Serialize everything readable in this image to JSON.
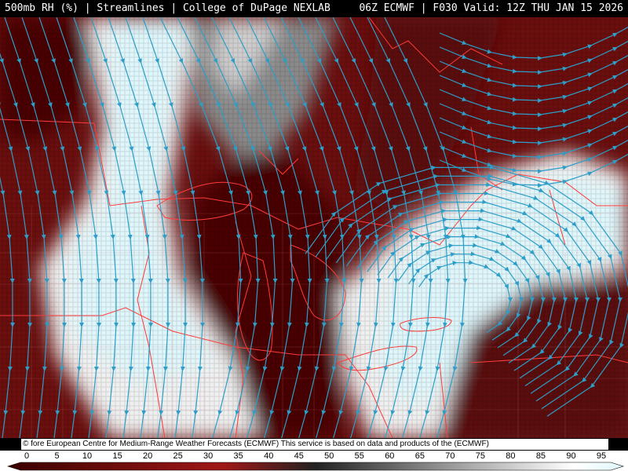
{
  "header": {
    "left": "500mb RH (%) | Streamlines | College of DuPage NEXLAB",
    "right": "06Z ECMWF | F030 Valid: 12Z THU JAN 15 2026"
  },
  "credit": "© fore European Centre for Medium-Range Weather Forecasts (ECMWF) This service is based on data and products of the (ECMWF)",
  "legend": {
    "ticks": [
      "0",
      "5",
      "10",
      "15",
      "20",
      "25",
      "30",
      "35",
      "40",
      "45",
      "50",
      "55",
      "60",
      "65",
      "70",
      "75",
      "80",
      "85",
      "90",
      "95"
    ]
  },
  "colors": {
    "dry_dark": "#5a0a0a",
    "dry_mid": "#8a1414",
    "moist_gray": "#9a9a9a",
    "moist_white": "#f2f2f2",
    "saturated_cyan": "#dff7fb",
    "streamline": "#2c9ec8",
    "borders": "#ff3a3a"
  }
}
